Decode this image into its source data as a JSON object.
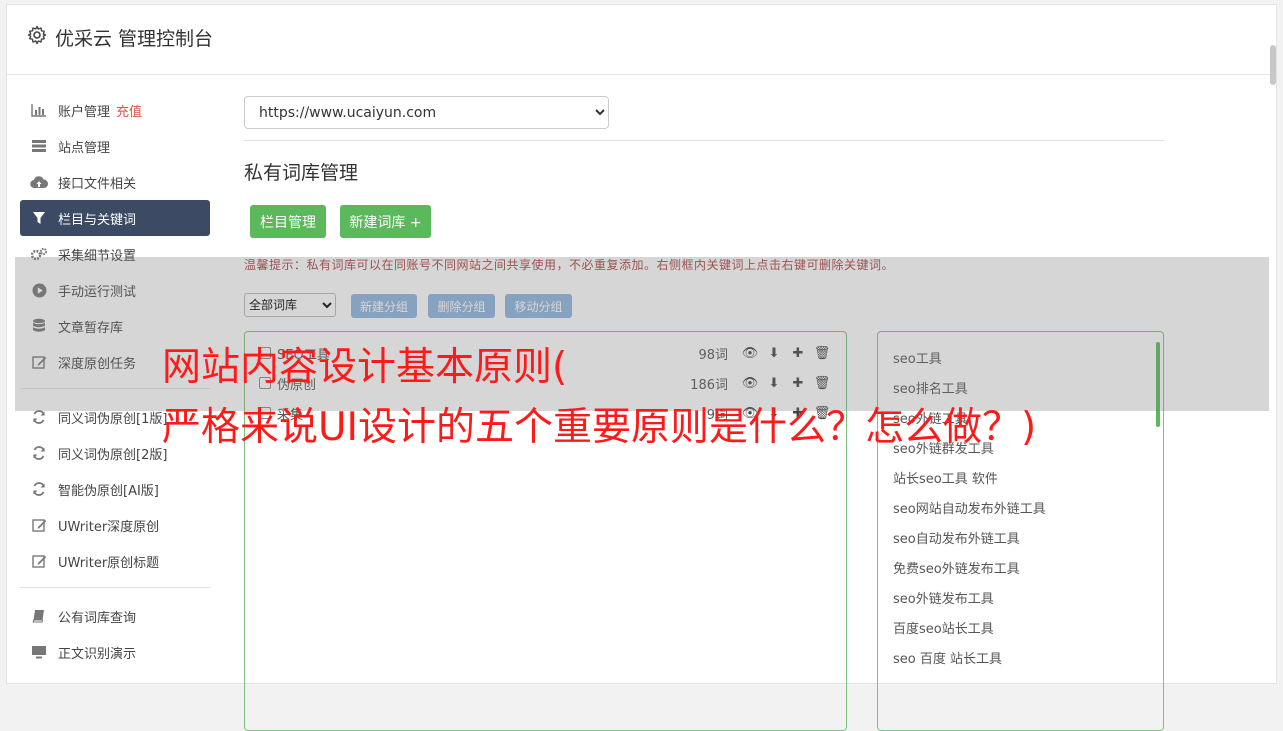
{
  "header": {
    "title": "优采云 管理控制台",
    "icon": "gear-icon"
  },
  "sidebar": {
    "items": [
      {
        "label": "账户管理",
        "extra": "充值",
        "icon": "bar-chart-icon"
      },
      {
        "label": "站点管理",
        "icon": "server-icon"
      },
      {
        "label": "接口文件相关",
        "icon": "cloud-upload-icon"
      },
      {
        "label": "栏目与关键词",
        "icon": "filter-icon",
        "active": true
      },
      {
        "label": "采集细节设置",
        "icon": "cogs-icon"
      },
      {
        "label": "手动运行测试",
        "icon": "play-circle-icon"
      },
      {
        "label": "文章暂存库",
        "icon": "database-icon"
      },
      {
        "label": "深度原创任务",
        "icon": "edit-icon"
      }
    ],
    "items2": [
      {
        "label": "同义词伪原创[1版]",
        "icon": "refresh-icon"
      },
      {
        "label": "同义词伪原创[2版]",
        "icon": "refresh-icon"
      },
      {
        "label": "智能伪原创[AI版]",
        "icon": "refresh-icon"
      },
      {
        "label": "UWriter深度原创",
        "icon": "edit-icon"
      },
      {
        "label": "UWriter原创标题",
        "icon": "edit-icon"
      }
    ],
    "items3": [
      {
        "label": "公有词库查询",
        "icon": "book-icon"
      },
      {
        "label": "正文识别演示",
        "icon": "monitor-icon"
      }
    ]
  },
  "main": {
    "site_select": {
      "value": "https://www.ucaiyun.com"
    },
    "section_title": "私有词库管理",
    "btn_columns": "栏目管理",
    "btn_new_lib": "新建词库 +",
    "tip": "温馨提示：私有词库可以在同账号不同网站之间共享使用，不必重复添加。右侧框内关键词上点击右键可删除关键词。",
    "filter_select": {
      "value": "全部词库"
    },
    "btn_new_group": "新建分组",
    "btn_delete_group": "删除分组",
    "btn_move_group": "移动分组",
    "libraries": [
      {
        "name": "SEO工具",
        "count": "98词"
      },
      {
        "name": "伪原创",
        "count": "186词"
      },
      {
        "name": "采集",
        "count": "9词"
      }
    ],
    "keywords": [
      "seo工具",
      "seo排名工具",
      "seo外链工具",
      "seo外链群发工具",
      "站长seo工具 软件",
      "seo网站自动发布外链工具",
      "seo自动发布外链工具",
      "免费seo外链发布工具",
      "seo外链发布工具",
      "百度seo站长工具",
      "seo 百度 站长工具"
    ]
  },
  "overlay": {
    "line1": "网站内容设计基本原则(",
    "line2": "严格来说UI设计的五个重要原则是什么？怎么做？)"
  }
}
